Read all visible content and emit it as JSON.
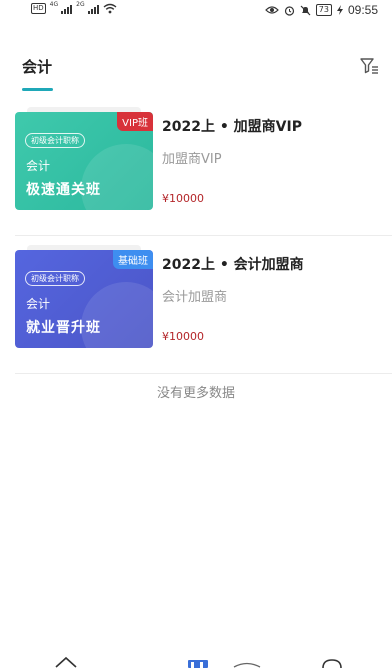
{
  "status_bar": {
    "left_chip": "HD",
    "signal_1_tag": "4G",
    "signal_2_tag": "2G",
    "battery": "73",
    "time": "09:55"
  },
  "header": {
    "active_tab": "会计",
    "accent_color": "#1fa8b8",
    "filter_icon": "filter-icon"
  },
  "courses": [
    {
      "badge": "VIP班",
      "cover_tag": "初级会计职称",
      "cover_subject": "会计",
      "cover_name": "极速通关班",
      "title": "2022上 • 加盟商VIP",
      "subtitle": "加盟商VIP",
      "price": "¥10000",
      "cover_color": "#3fc9ac"
    },
    {
      "badge": "基础班",
      "cover_tag": "初级会计职称",
      "cover_subject": "会计",
      "cover_name": "就业晋升班",
      "title": "2022上 • 会计加盟商",
      "subtitle": "会计加盟商",
      "price": "¥10000",
      "cover_color": "#5566df"
    }
  ],
  "list_footer": "没有更多数据",
  "bottom_nav": {
    "icons": [
      "home-icon",
      "course-icon",
      "discover-icon",
      "message-icon"
    ],
    "active_color": "#3a6fd8"
  }
}
